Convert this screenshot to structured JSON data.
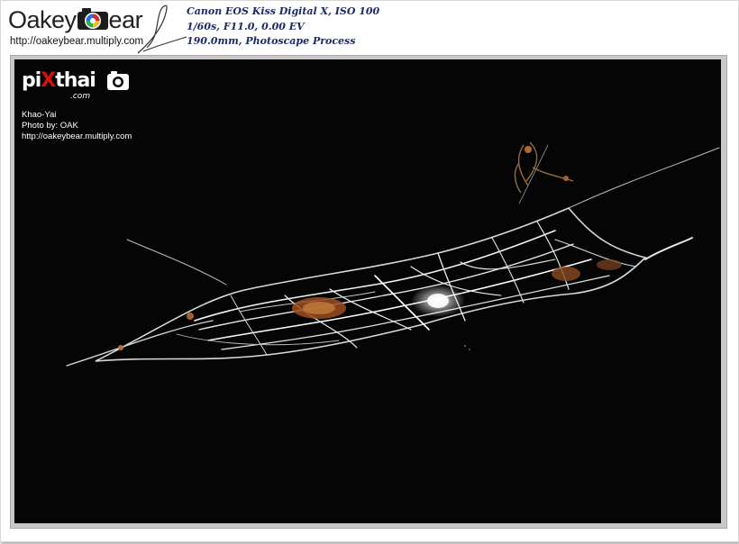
{
  "header": {
    "logo_left": "Oakey",
    "logo_right": "ear",
    "logo_url": "http://oakeybear.multiply.com",
    "exif": [
      "Canon EOS Kiss Digital X, ISO 100",
      "1/60s, F11.0, 0.00 EV",
      "190.0mm, Photoscape Process"
    ]
  },
  "watermark": {
    "brand_left": "pi",
    "brand_x": "X",
    "brand_right": "thai",
    "brand_suffix": ".com",
    "lines": [
      "Khao-Yai",
      "Photo by: OAK",
      "http://oakeybear.multiply.com"
    ]
  },
  "colors": {
    "photo_background": "#050505",
    "exif_text": "#1a2a6a",
    "watermark_x": "#d81010"
  },
  "photo": {
    "subject": "spider web at night"
  }
}
